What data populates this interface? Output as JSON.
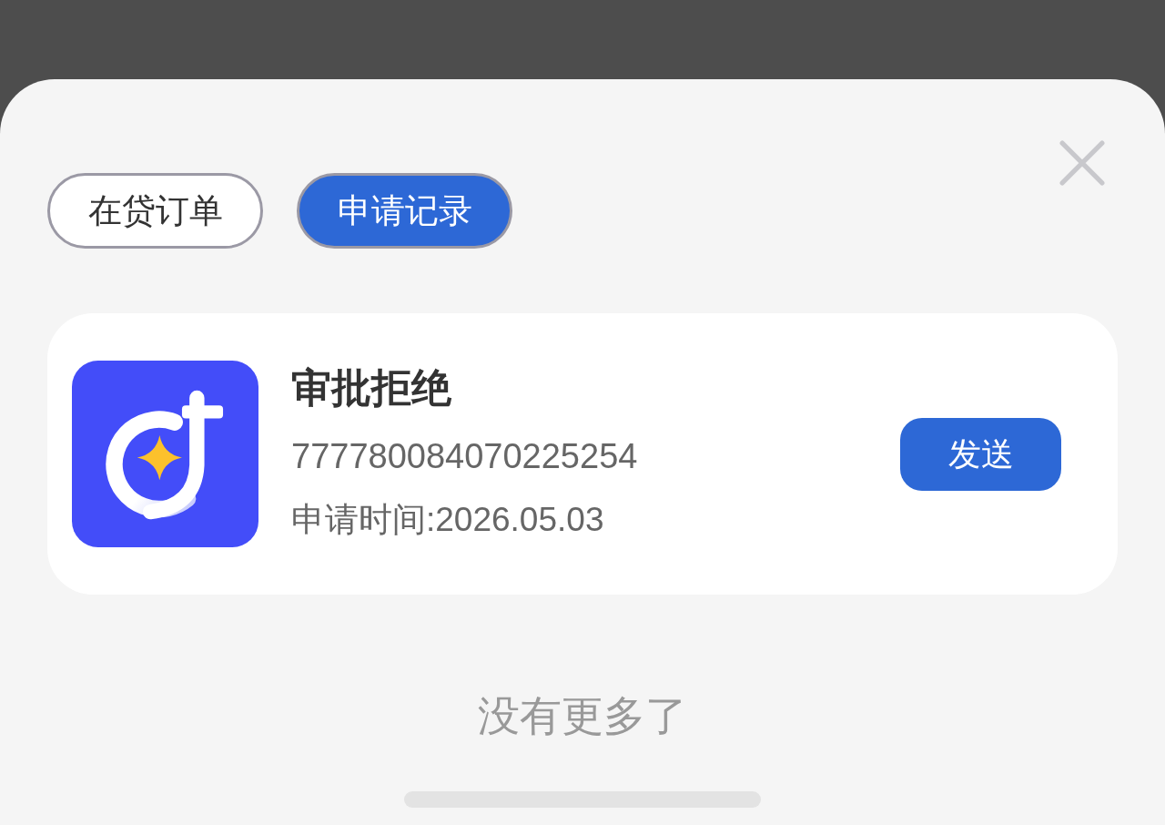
{
  "tabs": [
    {
      "label": "在贷订单",
      "selected": false
    },
    {
      "label": "申请记录",
      "selected": true
    }
  ],
  "records": [
    {
      "status": "审批拒绝",
      "number": "777780084070225254",
      "applied": "申请时间:2026.05.03",
      "button": "发送"
    }
  ],
  "footer": "没有更多了"
}
